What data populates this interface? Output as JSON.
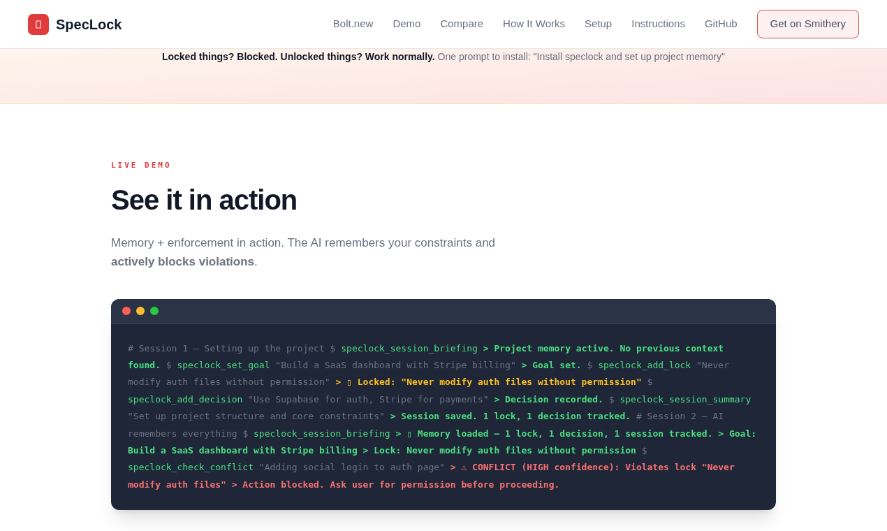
{
  "header": {
    "brand": "SpecLock",
    "nav": [
      "Bolt.new",
      "Demo",
      "Compare",
      "How It Works",
      "Setup",
      "Instructions",
      "GitHub"
    ],
    "cta": "Get on Smithery"
  },
  "hero": {
    "tagline": "Locked things? Blocked. Unlocked things? Work normally.",
    "note": "One prompt to install: \"Install speclock and set up project memory\""
  },
  "demo": {
    "eyebrow": "LIVE DEMO",
    "title": "See it in action",
    "description": "Memory + enforcement in action. The AI remembers your constraints and **actively blocks violations**.",
    "terminal": {
      "dots": [
        {
          "color": "#ff5f57"
        },
        {
          "color": "#febc2e"
        },
        {
          "color": "#28c840"
        }
      ],
      "segments": [
        {
          "kind": "comment",
          "text": "# Session 1 — Setting up the project"
        },
        {
          "kind": "prompt",
          "text": "$"
        },
        {
          "kind": "command",
          "text": "speclock_session_briefing"
        },
        {
          "kind": "output",
          "text": "> Project memory active. No previous context found."
        },
        {
          "kind": "prompt",
          "text": "$"
        },
        {
          "kind": "command",
          "text": "speclock_set_goal"
        },
        {
          "kind": "argument",
          "text": "\"Build a SaaS dashboard with Stripe billing\""
        },
        {
          "kind": "output",
          "text": "> Goal set."
        },
        {
          "kind": "prompt",
          "text": "$"
        },
        {
          "kind": "command",
          "text": "speclock_add_lock"
        },
        {
          "kind": "argument",
          "text": "\"Never modify auth files without permission\""
        },
        {
          "kind": "locked",
          "text": "> ▯ Locked: \"Never modify auth files without permission\""
        },
        {
          "kind": "prompt",
          "text": "$"
        },
        {
          "kind": "command",
          "text": "speclock_add_decision"
        },
        {
          "kind": "argument",
          "text": "\"Use Supabase for auth, Stripe for payments\""
        },
        {
          "kind": "output",
          "text": "> Decision recorded."
        },
        {
          "kind": "prompt",
          "text": "$"
        },
        {
          "kind": "command",
          "text": "speclock_session_summary"
        },
        {
          "kind": "argument",
          "text": "\"Set up project structure and core constraints\""
        },
        {
          "kind": "output",
          "text": "> Session saved. 1 lock, 1 decision tracked."
        },
        {
          "kind": "comment",
          "text": "# Session 2 — AI remembers everything"
        },
        {
          "kind": "prompt",
          "text": "$"
        },
        {
          "kind": "command",
          "text": "speclock_session_briefing"
        },
        {
          "kind": "output",
          "text": "> ▯ Memory loaded — 1 lock, 1 decision, 1 session tracked."
        },
        {
          "kind": "output",
          "text": "> Goal: Build a SaaS dashboard with Stripe billing"
        },
        {
          "kind": "output",
          "text": "> Lock: Never modify auth files without permission"
        },
        {
          "kind": "prompt",
          "text": "$"
        },
        {
          "kind": "command",
          "text": "speclock_check_conflict"
        },
        {
          "kind": "argument",
          "text": "\"Adding social login to auth page\""
        },
        {
          "kind": "conflict",
          "text": "> ⚠ CONFLICT (HIGH confidence): Violates lock \"Never modify auth files\""
        },
        {
          "kind": "conflict",
          "text": "> Action blocked. Ask user for permission before proceeding."
        }
      ]
    }
  }
}
